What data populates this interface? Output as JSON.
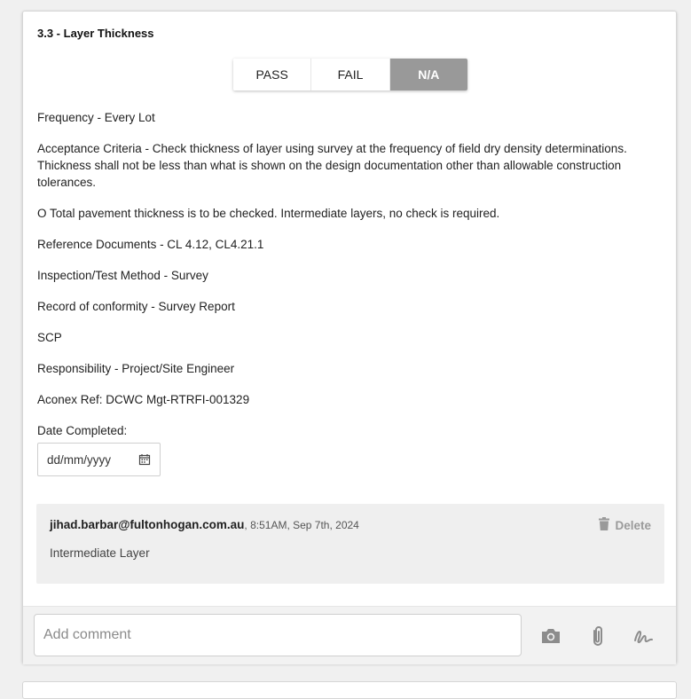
{
  "item": {
    "title": "3.3 - Layer Thickness"
  },
  "toggle": {
    "pass_label": "PASS",
    "fail_label": "FAIL",
    "na_label": "N/A",
    "selected": "N/A",
    "active_color": "#999999"
  },
  "details": {
    "frequency": "Frequency - Every Lot",
    "acceptance": "Acceptance Criteria - Check thickness of layer using survey at the frequency of field dry density determinations. Thickness shall not be less than what is shown on the design documentation other than allowable construction tolerances.",
    "note": "O Total pavement thickness is to be checked. Intermediate layers, no check is required.",
    "references": "Reference Documents - CL 4.12, CL4.21.1",
    "method": "Inspection/Test Method - Survey",
    "record": "Record of conformity - Survey Report",
    "scp": "SCP",
    "responsibility": "Responsibility - Project/Site Engineer",
    "aconex": "Aconex Ref: DCWC Mgt-RTRFI-001329"
  },
  "date": {
    "label": "Date Completed:",
    "placeholder": "dd/mm/yyyy",
    "icon": "calendar-icon"
  },
  "comment": {
    "author": "jihad.barbar@fultonhogan.com.au",
    "time": ", 8:51AM, Sep 7th, 2024",
    "text": "Intermediate Layer",
    "delete_label": "Delete",
    "delete_icon": "trash-icon"
  },
  "footer": {
    "placeholder": "Add comment",
    "icons": [
      "camera-icon",
      "paperclip-icon",
      "signature-icon"
    ]
  }
}
